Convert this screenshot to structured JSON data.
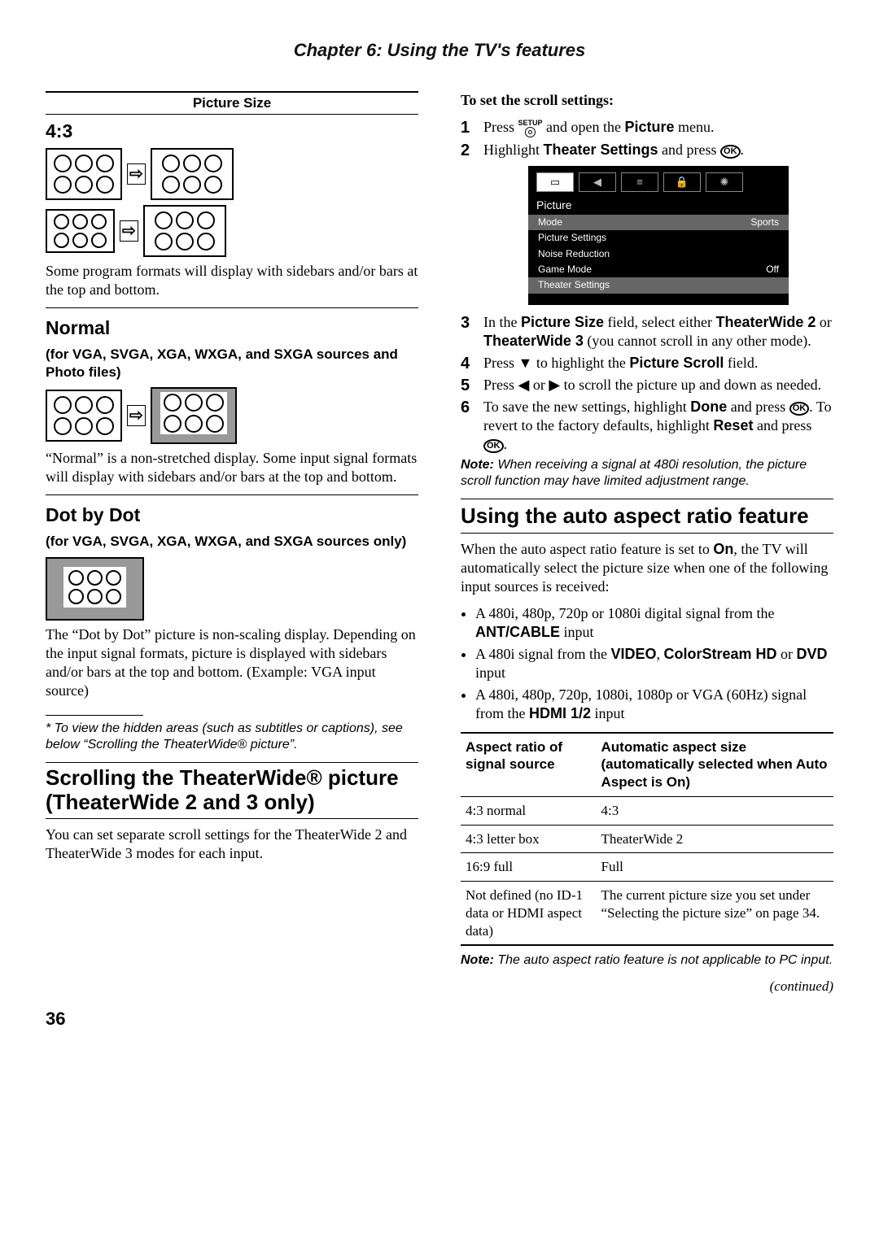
{
  "chapter": "Chapter 6: Using the TV's features",
  "pageNumber": "36",
  "continued": "(continued)",
  "left": {
    "picSizeHeader": "Picture Size",
    "s1": {
      "heading": "4:3",
      "caption": "Some program formats will display with sidebars and/or bars at the top and bottom."
    },
    "s2": {
      "heading": "Normal",
      "sub": "(for VGA, SVGA, XGA, WXGA, and SXGA sources and Photo files)",
      "caption": "“Normal” is a non-stretched display. Some input signal formats will display with sidebars and/or bars at the top and bottom."
    },
    "s3": {
      "heading": "Dot by Dot",
      "sub": "(for VGA, SVGA, XGA, WXGA, and SXGA sources only)",
      "caption": "The “Dot by Dot” picture is non-scaling display. Depending on the input signal formats, picture is displayed with sidebars and/or bars at the top and bottom. (Example: VGA input source)"
    },
    "footnote": "*  To view the hidden areas (such as subtitles or captions), see below “Scrolling the TheaterWide® picture”.",
    "s4": {
      "heading": "Scrolling the TheaterWide® picture (TheaterWide 2 and 3 only)",
      "caption": "You can set separate scroll settings for the TheaterWide 2 and TheaterWide 3 modes for each input."
    }
  },
  "right": {
    "heading": "To set the scroll settings:",
    "steps": {
      "1a": "Press ",
      "1b": " and open the ",
      "1c": "Picture",
      "1d": " menu.",
      "2a": "Highlight ",
      "2b": "Theater Settings",
      "2c": " and press ",
      "3a": "In the ",
      "3b": "Picture Size",
      "3c": " field, select either ",
      "3d": "TheaterWide 2",
      "3e": " or ",
      "3f": "TheaterWide 3",
      "3g": " (you cannot scroll in any other mode).",
      "4a": "Press ▼ to highlight the ",
      "4b": "Picture Scroll",
      "4c": " field.",
      "5": "Press ◀ or ▶ to scroll the picture up and down as needed.",
      "6a": "To save the new settings, highlight ",
      "6b": "Done",
      "6c": " and press ",
      "6d": ". To revert to the factory defaults, highlight ",
      "6e": "Reset",
      "6f": " and press "
    },
    "note1a": "Note:",
    "note1b": " When receiving a signal at 480i resolution, the picture scroll function may have limited adjustment range.",
    "menu": {
      "title": "Picture",
      "rows": [
        {
          "l": "Mode",
          "r": "Sports"
        },
        {
          "l": "Picture Settings",
          "r": ""
        },
        {
          "l": "Noise Reduction",
          "r": ""
        },
        {
          "l": "Game Mode",
          "r": "Off"
        },
        {
          "l": "Theater Settings",
          "r": ""
        }
      ]
    },
    "s5": {
      "heading": "Using the auto aspect ratio feature",
      "p1a": "When the auto aspect ratio feature is set to ",
      "p1b": "On",
      "p1c": ", the TV will automatically select the picture size when one of the following input sources is received:",
      "b1a": "A 480i, 480p, 720p or 1080i digital signal from the ",
      "b1b": "ANT/CABLE",
      "b1c": " input",
      "b2a": "A 480i signal from the ",
      "b2b": "VIDEO",
      "b2c": ", ",
      "b2d": "ColorStream HD",
      "b2e": " or ",
      "b2f": "DVD",
      "b2g": " input",
      "b3a": "A 480i, 480p, 720p, 1080i, 1080p or VGA (60Hz) signal from the ",
      "b3b": "HDMI 1/2",
      "b3c": " input"
    },
    "table": {
      "h1": "Aspect ratio of signal source",
      "h2": "Automatic aspect size (automatically selected when Auto Aspect is On)",
      "rows": [
        {
          "a": "4:3 normal",
          "b": "4:3"
        },
        {
          "a": "4:3 letter box",
          "b": "TheaterWide 2"
        },
        {
          "a": "16:9 full",
          "b": "Full"
        },
        {
          "a": "Not defined (no ID-1 data or HDMI aspect data)",
          "b": "The current picture size you set under “Selecting the picture size” on page 34."
        }
      ]
    },
    "note2a": "Note:",
    "note2b": " The auto aspect ratio feature is not applicable to PC input."
  }
}
